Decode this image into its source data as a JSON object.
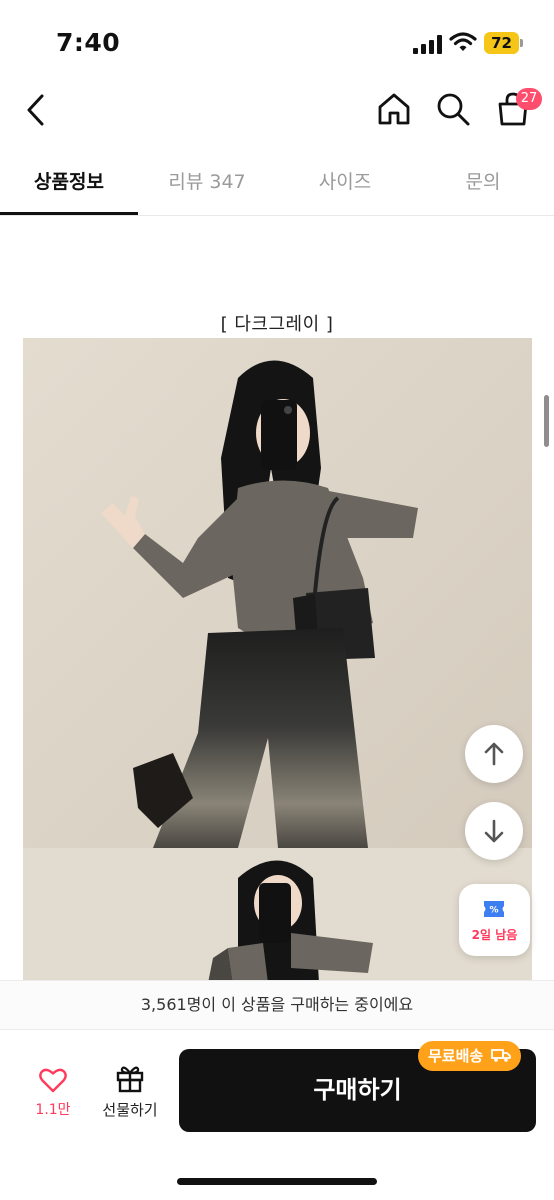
{
  "status_bar": {
    "time": "7:40",
    "battery_level": "72",
    "icons": [
      "signal-icon",
      "wifi-icon",
      "battery-icon"
    ]
  },
  "header": {
    "icons": [
      "back-icon",
      "home-icon",
      "search-icon",
      "cart-icon"
    ],
    "cart_badge": "27"
  },
  "tabs": [
    {
      "label": "상품정보",
      "active": true
    },
    {
      "label": "리뷰 347",
      "active": false
    },
    {
      "label": "사이즈",
      "active": false
    },
    {
      "label": "문의",
      "active": false
    }
  ],
  "content": {
    "color_caption": "[ 다크그레이 ]"
  },
  "floating": {
    "icons": [
      "arrow-up-icon",
      "arrow-down-icon",
      "coupon-icon"
    ],
    "coupon_label": "2일 남음"
  },
  "purchase_notice": "3,561명이 이 상품을 구매하는 중이에요",
  "bottom_bar": {
    "like_count": "1.1만",
    "gift_label": "선물하기",
    "buy_label": "구매하기",
    "free_shipping_label": "무료배송"
  },
  "colors": {
    "accent_pink": "#ff3a5c",
    "badge_pink": "#ff4d6d",
    "shipping_orange": "#ffa21a",
    "buy_button": "#111111",
    "inactive_tab": "#9a9a9a",
    "photo_background": "#ddd5c8"
  }
}
